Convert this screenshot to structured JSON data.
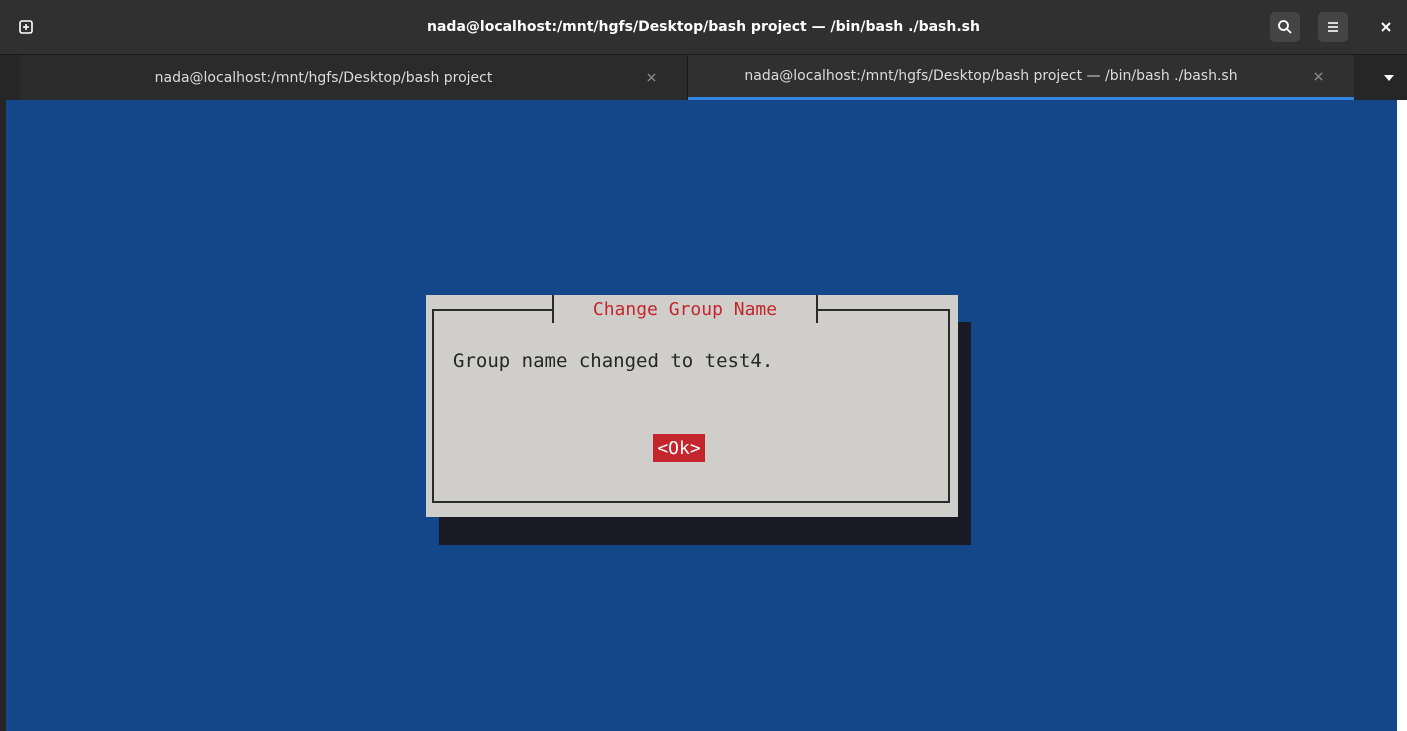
{
  "window": {
    "title": "nada@localhost:/mnt/hgfs/Desktop/bash project — /bin/bash ./bash.sh"
  },
  "icons": {
    "new_tab": "new-tab-icon",
    "search": "search-icon",
    "menu": "hamburger-menu-icon",
    "close": "close-icon",
    "tab_close": "close-icon",
    "tab_dropdown": "chevron-down-icon"
  },
  "tabs": [
    {
      "label": "nada@localhost:/mnt/hgfs/Desktop/bash project",
      "active": false
    },
    {
      "label": "nada@localhost:/mnt/hgfs/Desktop/bash project — /bin/bash ./bash.sh",
      "active": true
    }
  ],
  "dialog": {
    "title": "Change Group Name",
    "message": "Group name changed to test4.",
    "ok_label": "<Ok>"
  },
  "colors": {
    "terminal_background": "#13478a",
    "dialog_background": "#cfcecb",
    "accent_red": "#c4262e",
    "active_tab_indicator": "#3584e4"
  }
}
